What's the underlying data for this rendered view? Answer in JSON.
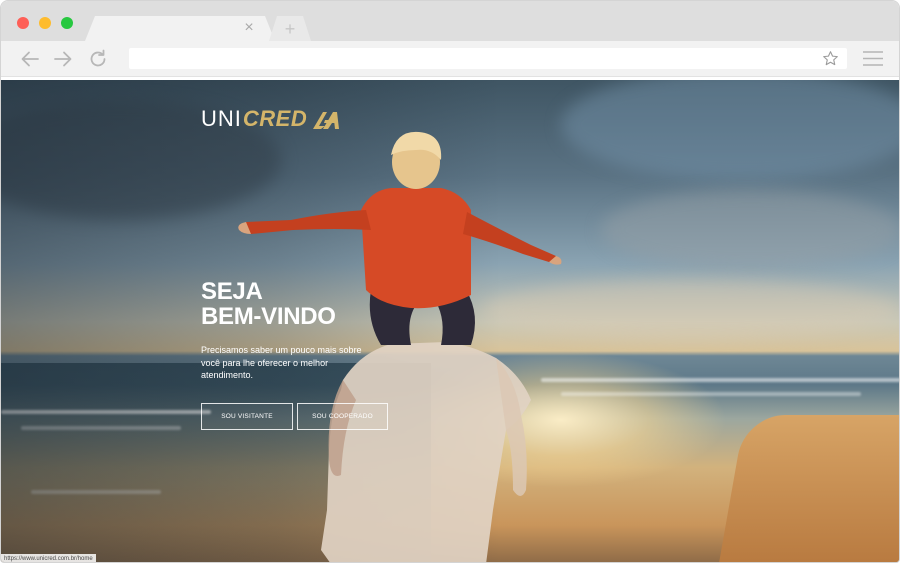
{
  "browser": {
    "tab": {
      "close_glyph": "×"
    },
    "new_tab_glyph": "+",
    "address_bar": {
      "value": ""
    },
    "icons": [
      "back-arrow-icon",
      "forward-arrow-icon",
      "reload-icon",
      "star-icon",
      "hamburger-menu-icon",
      "close-icon",
      "plus-icon"
    ],
    "status_url": "https://www.unicred.com.br/home"
  },
  "page": {
    "logo": {
      "uni": "UNI",
      "cred": "CRED"
    },
    "headline": {
      "line1": "SEJA",
      "line2": "BEM-VINDO"
    },
    "subtext": "Precisamos saber um pouco mais sobre você para lhe oferecer o melhor atendimento.",
    "buttons": {
      "visitor": "SOU VISITANTE",
      "member": "SOU COOPERADO"
    }
  },
  "colors": {
    "logo_gold": "#d4b56a",
    "text": "#ffffff",
    "traffic_red": "#fe5f57",
    "traffic_yellow": "#febc2e",
    "traffic_green": "#27c840"
  }
}
